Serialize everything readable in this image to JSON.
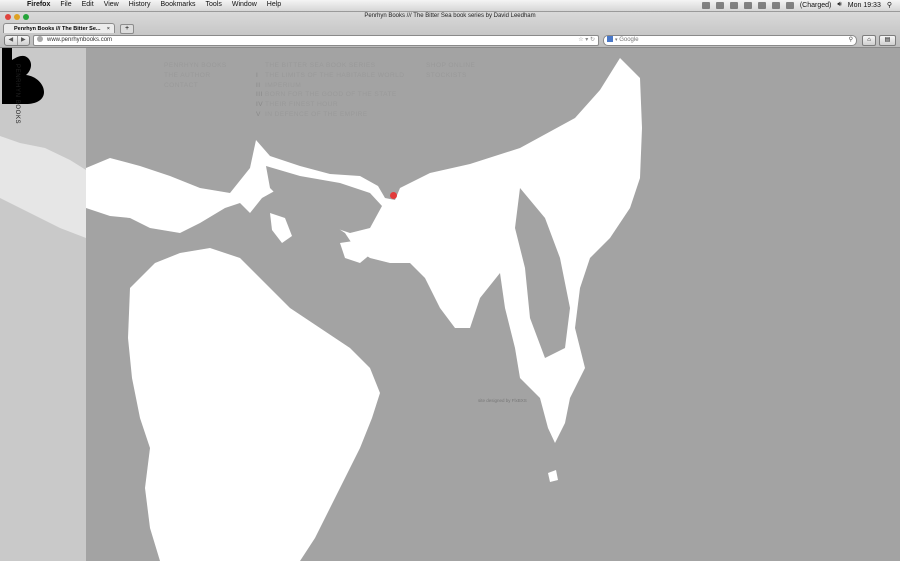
{
  "menubar": {
    "app": "Firefox",
    "menus": [
      "File",
      "Edit",
      "View",
      "History",
      "Bookmarks",
      "Tools",
      "Window",
      "Help"
    ],
    "window_title": "Penrhyn Books /// The Bitter Sea book series by David Leedham",
    "battery": "(Charged)",
    "clock": "Mon 19:33"
  },
  "browser": {
    "tab_title": "Penrhyn Books /// The Bitter Se...",
    "new_tab": "+",
    "url": "www.penrhynbooks.com",
    "search_placeholder": "Google"
  },
  "site": {
    "brand_vertical": "PENRHYN BOOKS",
    "nav_main": [
      "PENRHYN BOOKS",
      "THE AUTHOR",
      "CONTACT"
    ],
    "series_title": "THE BITTER SEA BOOK SERIES",
    "series_books": [
      {
        "num": "I",
        "title": "THE LIMITS OF THE HABITABLE WORLD"
      },
      {
        "num": "II",
        "title": "IMPERIUM"
      },
      {
        "num": "III",
        "title": "BORN FOR THE GOOD OF THE STATE"
      },
      {
        "num": "IV",
        "title": "THEIR FINEST HOUR"
      },
      {
        "num": "V",
        "title": "IN DEFENCE OF THE EMPIRE"
      }
    ],
    "nav_shop": [
      "SHOP ONLINE",
      "STOCKISTS"
    ],
    "credit": "site designed by FlxBXS"
  },
  "colors": {
    "sea": "#a3a3a3",
    "land": "#ffffff",
    "marker": "#e23b3b"
  }
}
